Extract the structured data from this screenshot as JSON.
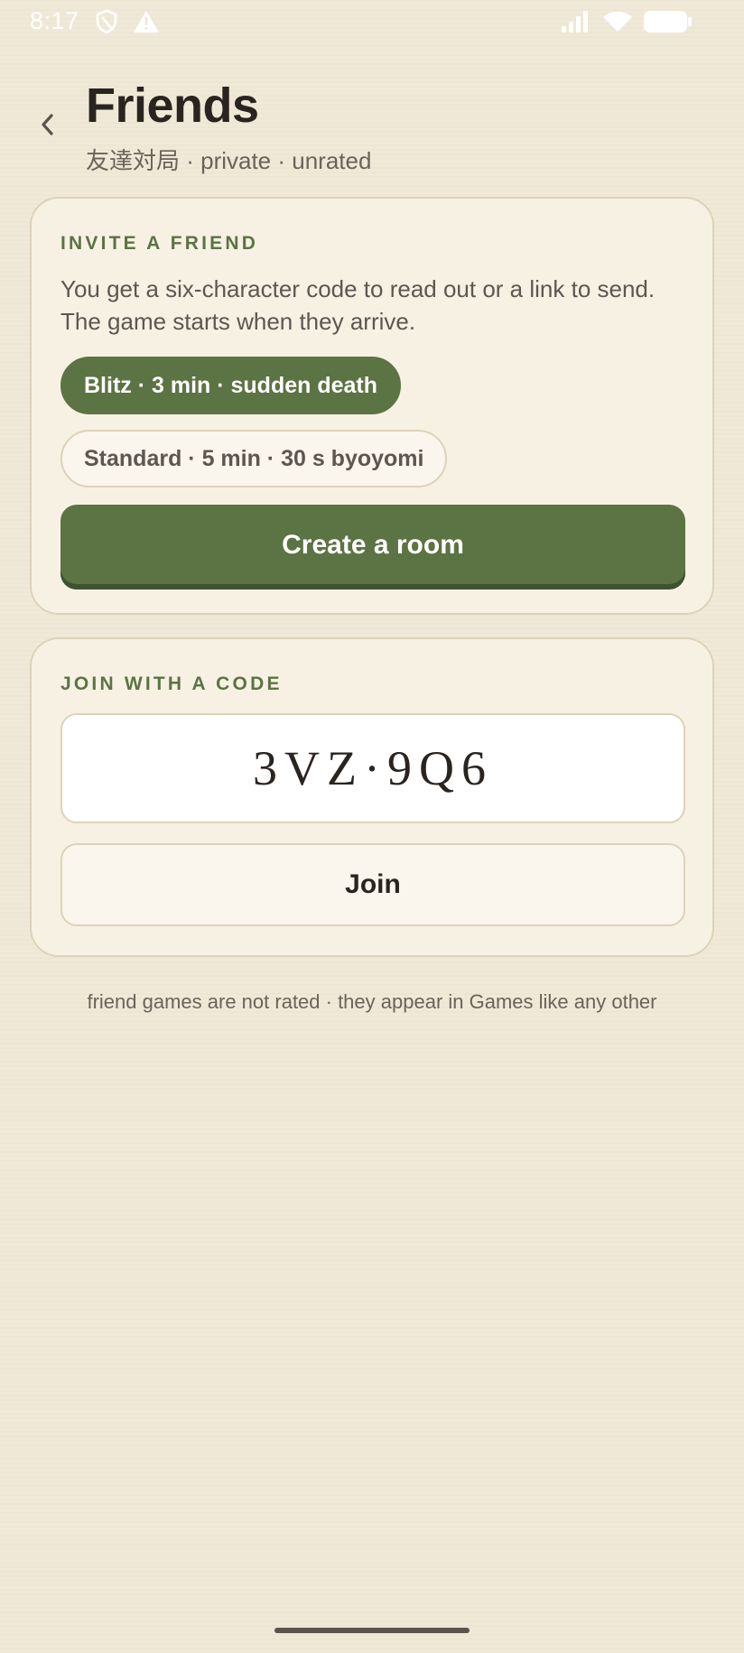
{
  "status_bar": {
    "time": "8:17",
    "icons": [
      "shield-icon",
      "alert-icon",
      "signal-icon",
      "wifi-icon",
      "battery-icon"
    ]
  },
  "header": {
    "back_icon": "chevron-left-icon",
    "title": "Friends",
    "subtitle": "友達対局 · private · unrated"
  },
  "invite": {
    "label": "INVITE A FRIEND",
    "description": "You get a six-character code to read out or a link to send. The game starts when they arrive.",
    "time_controls": [
      {
        "label": "Blitz · 3 min · sudden death",
        "selected": true
      },
      {
        "label": "Standard · 5 min · 30 s byoyomi",
        "selected": false
      }
    ],
    "create_label": "Create a room"
  },
  "join": {
    "label": "JOIN WITH A CODE",
    "code_value": "3VZ·9Q6",
    "join_label": "Join"
  },
  "footer": {
    "note": "friend games are not rated · they appear in Games like any other"
  },
  "colors": {
    "background": "#f1e9d7",
    "card": "#f7f1e4",
    "card_border": "#ddd2b9",
    "accent_green": "#5c7343",
    "text_dark": "#2a2420",
    "text_muted": "#6b625a"
  }
}
